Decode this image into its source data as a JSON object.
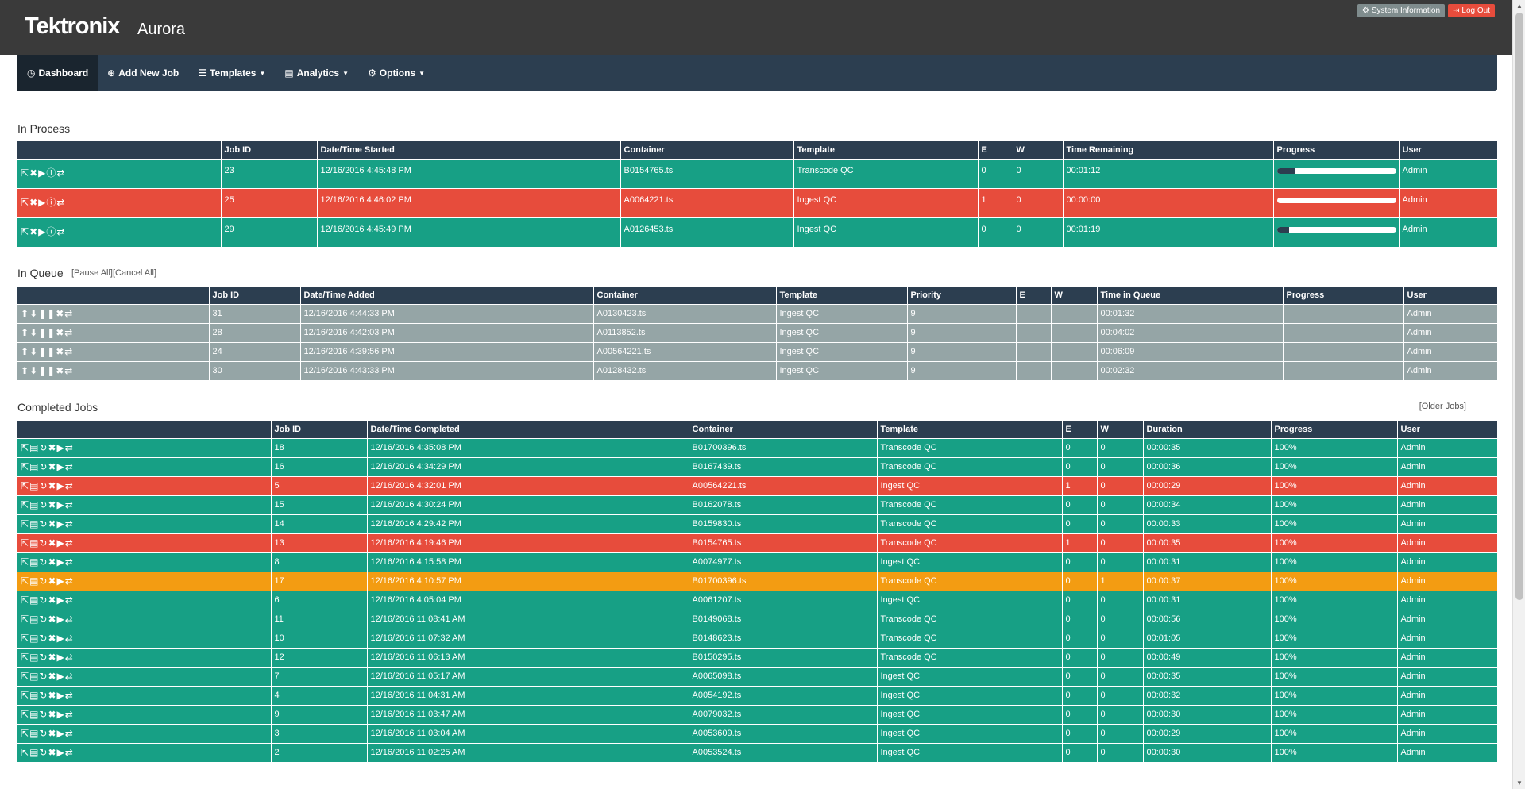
{
  "header": {
    "brand": "Tektronix",
    "product": "Aurora",
    "system_info_label": "System Information",
    "logout_label": "Log Out"
  },
  "nav": {
    "dashboard": "Dashboard",
    "add_new_job": "Add New Job",
    "templates": "Templates",
    "analytics": "Analytics",
    "options": "Options"
  },
  "in_process": {
    "title": "In Process",
    "columns": [
      "",
      "Job ID",
      "Date/Time Started",
      "Container",
      "Template",
      "E",
      "W",
      "Time Remaining",
      "Progress",
      "User"
    ],
    "rows": [
      {
        "status": "green",
        "job_id": "23",
        "started": "12/16/2016 4:45:48 PM",
        "container": "B0154765.ts",
        "template": "Transcode QC",
        "e": "0",
        "w": "0",
        "remaining": "00:01:12",
        "progress": 0.15,
        "user": "Admin"
      },
      {
        "status": "red",
        "job_id": "25",
        "started": "12/16/2016 4:46:02 PM",
        "container": "A0064221.ts",
        "template": "Ingest QC",
        "e": "1",
        "w": "0",
        "remaining": "00:00:00",
        "progress": 0.0,
        "user": "Admin"
      },
      {
        "status": "green",
        "job_id": "29",
        "started": "12/16/2016 4:45:49 PM",
        "container": "A0126453.ts",
        "template": "Ingest QC",
        "e": "0",
        "w": "0",
        "remaining": "00:01:19",
        "progress": 0.1,
        "user": "Admin"
      }
    ]
  },
  "in_queue": {
    "title": "In Queue",
    "pause_all": "[Pause All]",
    "cancel_all": "[Cancel All]",
    "columns": [
      "",
      "Job ID",
      "Date/Time Added",
      "Container",
      "Template",
      "Priority",
      "E",
      "W",
      "Time in Queue",
      "Progress",
      "User"
    ],
    "rows": [
      {
        "job_id": "31",
        "added": "12/16/2016 4:44:33 PM",
        "container": "A0130423.ts",
        "template": "Ingest QC",
        "priority": "9",
        "e": "",
        "w": "",
        "time": "00:01:32",
        "progress": "",
        "user": "Admin"
      },
      {
        "job_id": "28",
        "added": "12/16/2016 4:42:03 PM",
        "container": "A0113852.ts",
        "template": "Ingest QC",
        "priority": "9",
        "e": "",
        "w": "",
        "time": "00:04:02",
        "progress": "",
        "user": "Admin"
      },
      {
        "job_id": "24",
        "added": "12/16/2016 4:39:56 PM",
        "container": "A00564221.ts",
        "template": "Ingest QC",
        "priority": "9",
        "e": "",
        "w": "",
        "time": "00:06:09",
        "progress": "",
        "user": "Admin"
      },
      {
        "job_id": "30",
        "added": "12/16/2016 4:43:33 PM",
        "container": "A0128432.ts",
        "template": "Ingest QC",
        "priority": "9",
        "e": "",
        "w": "",
        "time": "00:02:32",
        "progress": "",
        "user": "Admin"
      }
    ]
  },
  "completed": {
    "title": "Completed Jobs",
    "older_jobs": "[Older Jobs]",
    "columns": [
      "",
      "Job ID",
      "Date/Time Completed",
      "Container",
      "Template",
      "E",
      "W",
      "Duration",
      "Progress",
      "User"
    ],
    "rows": [
      {
        "status": "green",
        "job_id": "18",
        "completed": "12/16/2016 4:35:08 PM",
        "container": "B01700396.ts",
        "template": "Transcode QC",
        "e": "0",
        "w": "0",
        "duration": "00:00:35",
        "progress": "100%",
        "user": "Admin"
      },
      {
        "status": "green",
        "job_id": "16",
        "completed": "12/16/2016 4:34:29 PM",
        "container": "B0167439.ts",
        "template": "Transcode QC",
        "e": "0",
        "w": "0",
        "duration": "00:00:36",
        "progress": "100%",
        "user": "Admin"
      },
      {
        "status": "red",
        "job_id": "5",
        "completed": "12/16/2016 4:32:01 PM",
        "container": "A00564221.ts",
        "template": "Ingest QC",
        "e": "1",
        "w": "0",
        "duration": "00:00:29",
        "progress": "100%",
        "user": "Admin"
      },
      {
        "status": "green",
        "job_id": "15",
        "completed": "12/16/2016 4:30:24 PM",
        "container": "B0162078.ts",
        "template": "Transcode QC",
        "e": "0",
        "w": "0",
        "duration": "00:00:34",
        "progress": "100%",
        "user": "Admin"
      },
      {
        "status": "green",
        "job_id": "14",
        "completed": "12/16/2016 4:29:42 PM",
        "container": "B0159830.ts",
        "template": "Transcode QC",
        "e": "0",
        "w": "0",
        "duration": "00:00:33",
        "progress": "100%",
        "user": "Admin"
      },
      {
        "status": "red",
        "job_id": "13",
        "completed": "12/16/2016 4:19:46 PM",
        "container": "B0154765.ts",
        "template": "Transcode QC",
        "e": "1",
        "w": "0",
        "duration": "00:00:35",
        "progress": "100%",
        "user": "Admin"
      },
      {
        "status": "green",
        "job_id": "8",
        "completed": "12/16/2016 4:15:58 PM",
        "container": "A0074977.ts",
        "template": "Ingest QC",
        "e": "0",
        "w": "0",
        "duration": "00:00:31",
        "progress": "100%",
        "user": "Admin"
      },
      {
        "status": "orange",
        "job_id": "17",
        "completed": "12/16/2016 4:10:57 PM",
        "container": "B01700396.ts",
        "template": "Transcode QC",
        "e": "0",
        "w": "1",
        "duration": "00:00:37",
        "progress": "100%",
        "user": "Admin"
      },
      {
        "status": "green",
        "job_id": "6",
        "completed": "12/16/2016 4:05:04 PM",
        "container": "A0061207.ts",
        "template": "Ingest QC",
        "e": "0",
        "w": "0",
        "duration": "00:00:31",
        "progress": "100%",
        "user": "Admin"
      },
      {
        "status": "green",
        "job_id": "11",
        "completed": "12/16/2016 11:08:41 AM",
        "container": "B0149068.ts",
        "template": "Transcode QC",
        "e": "0",
        "w": "0",
        "duration": "00:00:56",
        "progress": "100%",
        "user": "Admin"
      },
      {
        "status": "green",
        "job_id": "10",
        "completed": "12/16/2016 11:07:32 AM",
        "container": "B0148623.ts",
        "template": "Transcode QC",
        "e": "0",
        "w": "0",
        "duration": "00:01:05",
        "progress": "100%",
        "user": "Admin"
      },
      {
        "status": "green",
        "job_id": "12",
        "completed": "12/16/2016 11:06:13 AM",
        "container": "B0150295.ts",
        "template": "Transcode QC",
        "e": "0",
        "w": "0",
        "duration": "00:00:49",
        "progress": "100%",
        "user": "Admin"
      },
      {
        "status": "green",
        "job_id": "7",
        "completed": "12/16/2016 11:05:17 AM",
        "container": "A0065098.ts",
        "template": "Ingest QC",
        "e": "0",
        "w": "0",
        "duration": "00:00:35",
        "progress": "100%",
        "user": "Admin"
      },
      {
        "status": "green",
        "job_id": "4",
        "completed": "12/16/2016 11:04:31 AM",
        "container": "A0054192.ts",
        "template": "Ingest QC",
        "e": "0",
        "w": "0",
        "duration": "00:00:32",
        "progress": "100%",
        "user": "Admin"
      },
      {
        "status": "green",
        "job_id": "9",
        "completed": "12/16/2016 11:03:47 AM",
        "container": "A0079032.ts",
        "template": "Ingest QC",
        "e": "0",
        "w": "0",
        "duration": "00:00:30",
        "progress": "100%",
        "user": "Admin"
      },
      {
        "status": "green",
        "job_id": "3",
        "completed": "12/16/2016 11:03:04 AM",
        "container": "A0053609.ts",
        "template": "Ingest QC",
        "e": "0",
        "w": "0",
        "duration": "00:00:29",
        "progress": "100%",
        "user": "Admin"
      },
      {
        "status": "green",
        "job_id": "2",
        "completed": "12/16/2016 11:02:25 AM",
        "container": "A0053524.ts",
        "template": "Ingest QC",
        "e": "0",
        "w": "0",
        "duration": "00:00:30",
        "progress": "100%",
        "user": "Admin"
      }
    ]
  }
}
